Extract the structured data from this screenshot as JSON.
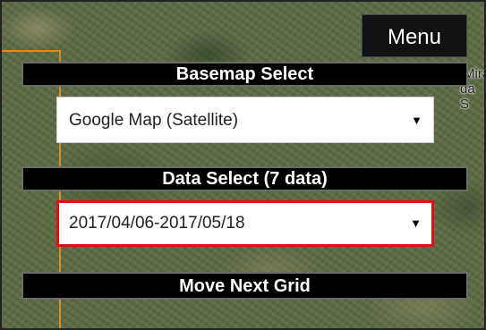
{
  "menu": {
    "label": "Menu"
  },
  "map": {
    "place_label_line1": "Mira",
    "place_label_line2": "da S"
  },
  "basemap": {
    "header": "Basemap Select",
    "selected": "Google Map (Satellite)"
  },
  "data": {
    "header": "Data Select (7 data)",
    "selected": "2017/04/06-2017/05/18"
  },
  "actions": {
    "move_next_grid": "Move Next Grid"
  },
  "colors": {
    "grid_line": "#e38a1c",
    "active_select_border": "#d11111",
    "panel_bar": "#000000"
  },
  "icons": {
    "dropdown": "triangle-down-icon"
  }
}
